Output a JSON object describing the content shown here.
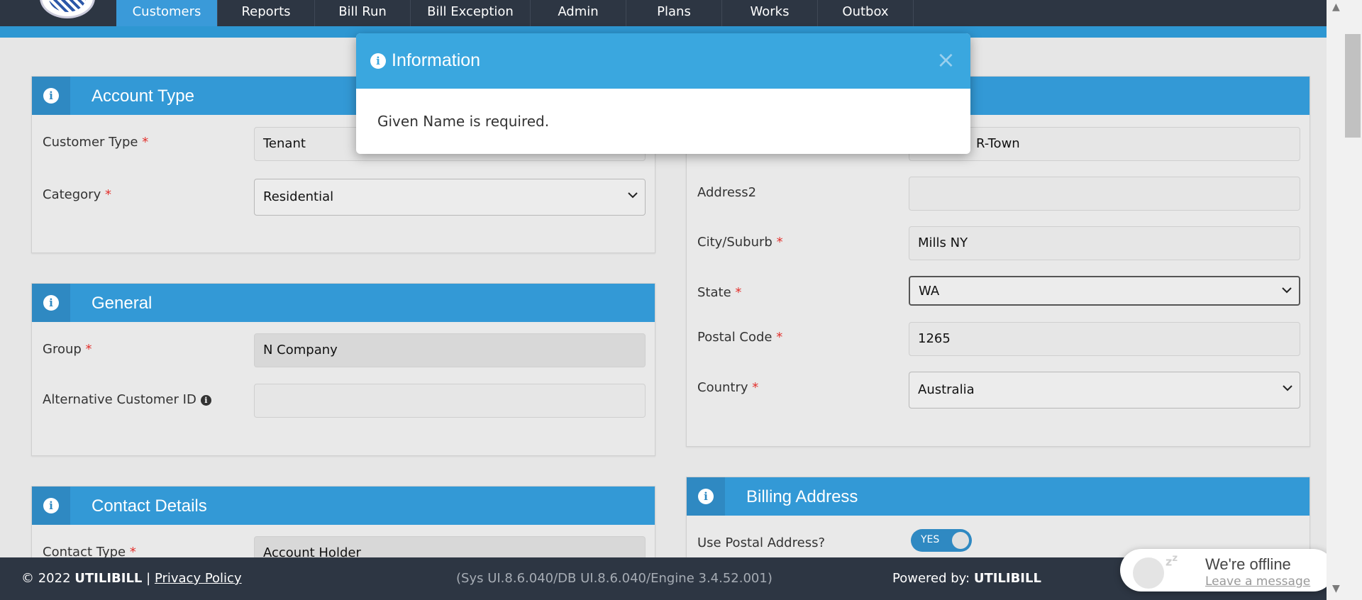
{
  "nav": {
    "items": [
      {
        "label": "Customers",
        "active": true
      },
      {
        "label": "Reports"
      },
      {
        "label": "Bill Run"
      },
      {
        "label": "Bill Exception"
      },
      {
        "label": "Admin"
      },
      {
        "label": "Plans"
      },
      {
        "label": "Works"
      },
      {
        "label": "Outbox"
      }
    ]
  },
  "account_type": {
    "title": "Account Type",
    "customer_type_label": "Customer Type",
    "customer_type_value": "Tenant",
    "category_label": "Category",
    "category_value": "Residential"
  },
  "general": {
    "title": "General",
    "group_label": "Group",
    "group_value": "N Company",
    "alt_id_label": "Alternative Customer ID",
    "alt_id_value": ""
  },
  "contact_details": {
    "title": "Contact Details",
    "contact_type_label": "Contact Type",
    "contact_type_value": "Account Holder"
  },
  "address": {
    "address1_value": "R-Town",
    "address2_label": "Address2",
    "address2_value": "",
    "city_label": "City/Suburb",
    "city_value": "Mills NY",
    "state_label": "State",
    "state_value": "WA",
    "postal_label": "Postal Code",
    "postal_value": "1265",
    "country_label": "Country",
    "country_value": "Australia"
  },
  "billing_address": {
    "title": "Billing Address",
    "use_postal_label": "Use Postal Address?",
    "use_postal_value": "YES"
  },
  "required_marker": "*",
  "modal": {
    "title": "Information",
    "close": "×",
    "message": "Given Name is required."
  },
  "footer": {
    "copyright_prefix": "© 2022",
    "brand": "UTILIBILL",
    "separator": "|",
    "privacy": "Privacy Policy",
    "version": "(Sys UI.8.6.040/DB UI.8.6.040/Engine 3.4.52.001)",
    "powered_prefix": "Powered by:",
    "powered_brand": "UTILIBILL"
  },
  "chat": {
    "title": "We're offline",
    "link": "Leave a message"
  },
  "colors": {
    "nav_bg": "#2d3643",
    "accent": "#3399d6",
    "modal_header": "#3aa7df",
    "required": "#e3312d"
  }
}
